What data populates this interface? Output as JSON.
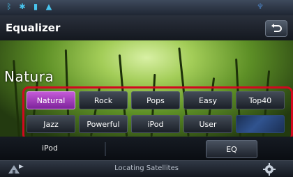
{
  "header": {
    "title": "Equalizer"
  },
  "preset": {
    "current_name": "Natura"
  },
  "presets": [
    {
      "label": "Natural",
      "active": true
    },
    {
      "label": "Rock",
      "active": false
    },
    {
      "label": "Pops",
      "active": false
    },
    {
      "label": "Easy",
      "active": false
    },
    {
      "label": "Top40",
      "active": false
    },
    {
      "label": "Jazz",
      "active": false
    },
    {
      "label": "Powerful",
      "active": false
    },
    {
      "label": "iPod",
      "active": false
    },
    {
      "label": "User",
      "active": false
    }
  ],
  "source": {
    "label": "iPod",
    "eq_button": "EQ"
  },
  "footer": {
    "status": "Locating Satellites"
  },
  "colors": {
    "active_preset": "#9b3bb8",
    "highlight_frame": "#d2081f",
    "accent_icons": "#48c4ee"
  },
  "icons": {
    "status": [
      "bluetooth-icon",
      "settings-icon",
      "battery-icon",
      "warning-icon"
    ],
    "back": "return-arrow-icon",
    "nav": "navigation-icon",
    "setup": "gear-icon"
  }
}
